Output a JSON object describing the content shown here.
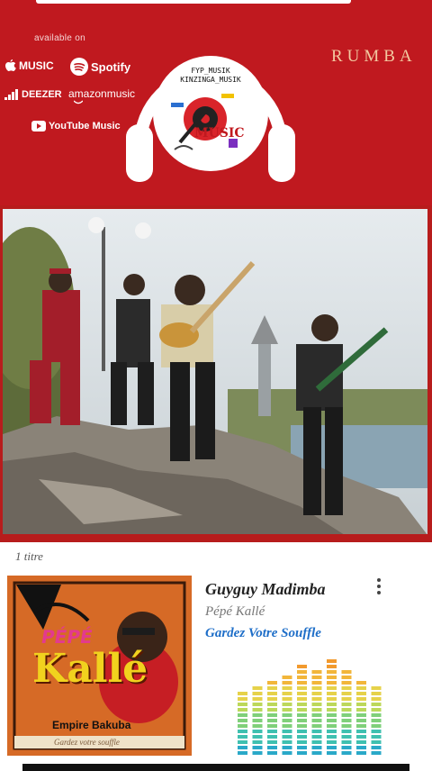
{
  "header": {
    "available_label": "available on",
    "platforms": [
      {
        "name": "MUSIC",
        "icon": "apple-icon"
      },
      {
        "name": "Spotify",
        "icon": "spotify-icon"
      },
      {
        "name": "DEEZER",
        "icon": "deezer-icon"
      },
      {
        "name": "amazonmusic",
        "icon": "amazon-music-icon"
      },
      {
        "name": "YouTube Music",
        "icon": "youtube-icon"
      }
    ],
    "genre": "RUMBA",
    "logo_line1": "FYP_MUSIK",
    "logo_line2": "KINZINGA_MUSIK",
    "logo_word": "MUSIC"
  },
  "player": {
    "one_title": "1 titre",
    "song_title": "Guyguy Madimba",
    "artist": "Pépé Kallé",
    "album": "Gardez Votre Souffle",
    "cover": {
      "name_line1": "PÉPÉ",
      "name_line2": "Kallé",
      "group": "Empire Bakuba",
      "subtitle": "Gardez votre souffle"
    },
    "eq_levels": [
      0.62,
      0.68,
      0.74,
      0.8,
      0.92,
      0.86,
      0.96,
      0.82,
      0.72,
      0.66
    ]
  },
  "colors": {
    "brand_red": "#c0191f",
    "genre_text": "#f2c9a0",
    "album_blue": "#1e6ec8"
  }
}
